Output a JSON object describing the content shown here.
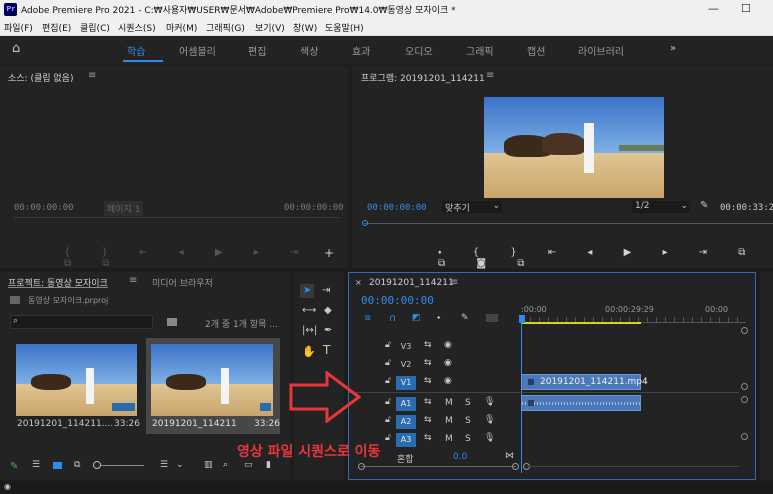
{
  "titlebar": {
    "logo": "Pr",
    "title": "Adobe Premiere Pro 2021 - C:₩사용자₩USER₩문서₩Adobe₩Premiere Pro₩14.0₩동영상 모자이크 *",
    "minimize": "—",
    "maximize": "☐"
  },
  "menu": [
    "파일(F)",
    "편집(E)",
    "클립(C)",
    "시퀀스(S)",
    "마커(M)",
    "그래픽(G)",
    "보기(V)",
    "창(W)",
    "도움말(H)"
  ],
  "workspaces": [
    "학습",
    "어셈블리",
    "편집",
    "색상",
    "효과",
    "오디오",
    "그래픽",
    "캡션",
    "라이브러리"
  ],
  "workspace_active": "학습",
  "source": {
    "title": "소스: (클립 없음)",
    "tc_left": "00:00:00:00",
    "page": "페이지 1",
    "tc_right": "00:00:00:00"
  },
  "program": {
    "title": "프로그램: 20191201_114211",
    "tc_left": "00:00:00:00",
    "fit": "맞추기",
    "quality": "1/2",
    "tc_right": "00:00:33:26"
  },
  "project": {
    "tab_active": "프로젝트: 동영상 모자이크",
    "tab_other": "미디어 브라우저",
    "file": "동영상 모자이크.prproj",
    "count": "2개 중 1개 항목 ...",
    "items": [
      {
        "name": "20191201_114211....",
        "duration": "33:26"
      },
      {
        "name": "20191201_114211",
        "duration": "33:26"
      }
    ]
  },
  "timeline": {
    "seq_name": "20191201_114211",
    "tc": "00:00:00:00",
    "ruler": [
      ":00:00",
      "00:00:29:29",
      "00:00"
    ],
    "video_tracks": [
      "V3",
      "V2",
      "V1"
    ],
    "audio_tracks": [
      "A1",
      "A2",
      "A3"
    ],
    "track_m": "M",
    "track_s": "S",
    "clip_name": "20191201_114211.mp4",
    "master": "혼합",
    "master_val": "0.0"
  },
  "annotation": {
    "text": "영상 파일 시퀀스로 이동",
    "color": "#e8363d"
  },
  "colors": {
    "accent": "#2d8ceb",
    "track_on": "#2a6cb0",
    "clip": "#4a78b8",
    "playhead": "#2d8ceb"
  }
}
